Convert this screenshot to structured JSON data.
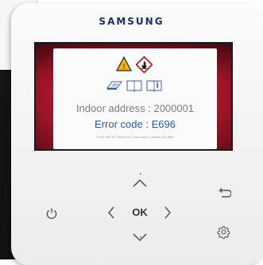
{
  "device": {
    "brand": "SAMSUNG"
  },
  "screen": {
    "icons": [
      "warning-triangle-icon",
      "flammable-hazard-icon",
      "manual-icon",
      "open-book-icon",
      "info-book-icon"
    ],
    "indoor_address": "Indoor address : 2000001",
    "error_code": "Error code : E696",
    "instruction": "Press the 'OK' button for 3 seconds to dismiss the alert"
  },
  "buttons": {
    "ok_label": "OK",
    "icons": [
      "power-icon",
      "left-arrow-icon",
      "right-arrow-icon",
      "up-arrow-icon",
      "down-arrow-icon",
      "back-icon",
      "settings-gear-icon"
    ]
  },
  "colors": {
    "brand": "#1c2d6b",
    "screen_frame": "#a6162a",
    "error_text": "#2a5da8",
    "address_text": "#7d7d7d"
  }
}
